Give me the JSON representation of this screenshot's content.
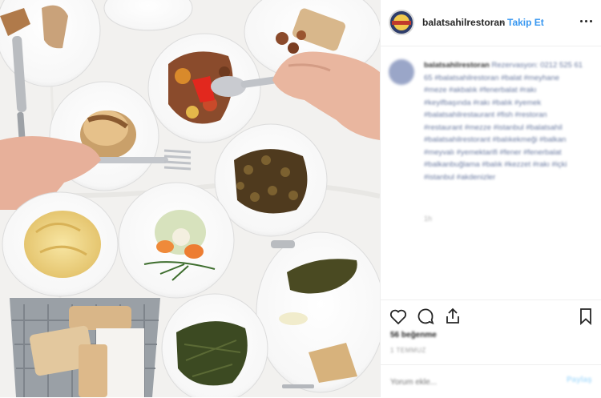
{
  "post": {
    "username": "balatsahilrestoran",
    "separator": "•",
    "follow_label": "Takip Et",
    "avatar_text": "Sahil Restoran",
    "caption": {
      "username": "balatsahilrestoran",
      "text": "Rezervasyon: 0212 525 61 65 #balatsahilrestoran #balat #meyhane #meze #akbalık #fenerbalat #rakı #keyifbaşında #rakı #balık #yemek #balatsahilrestaurant #fish #restoran #restaurant #mezze #istanbul #balatsahil #balatsahilrestorant #balıkekmeği #balkan #meyvalı #yemektarifi #fener #fenerbalat #balkanbuğlama #balık #kezzet #rakı #içki #istanbul #akdenizler"
    },
    "time_ago": "1h",
    "likes": "56 beğenme",
    "date": "1 TEMMUZ",
    "comment_placeholder": "Yorum ekle...",
    "post_label": "Paylaş"
  },
  "icons": {
    "more": "more-options-icon",
    "like": "heart-icon",
    "comment": "comment-icon",
    "share": "share-icon",
    "save": "bookmark-icon"
  },
  "colors": {
    "follow": "#3897f0",
    "border": "#efefef",
    "text": "#262626"
  }
}
